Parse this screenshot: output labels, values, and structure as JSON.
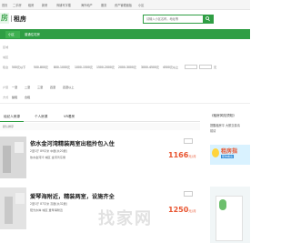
{
  "topnav": {
    "items": [
      "首页",
      "二手房",
      "租房",
      "新房",
      "商铺写字楼",
      "海外地产",
      "服务",
      "资产管理面板",
      "小区"
    ]
  },
  "header": {
    "logo_mark": "房",
    "title": "租房",
    "search_placeholder": "请输入小区名称，地址等"
  },
  "greenbar": {
    "items": [
      "小区",
      "普通住宅房",
      "",
      "",
      "",
      ""
    ]
  },
  "filters": {
    "rows": [
      {
        "key": "区域",
        "items": [
          "",
          "",
          "",
          "",
          "",
          "",
          "",
          "",
          "",
          ""
        ]
      },
      {
        "key": "城区",
        "items": []
      },
      {
        "key": "租金",
        "items": [
          "500元以下",
          "500-800元",
          "800-1000元",
          "1000-1500元",
          "1500-2000元",
          "2000-3000元",
          "3000-4500元",
          "4500元以上",
          ""
        ]
      },
      {
        "key": "",
        "items": [
          "",
          "",
          "",
          ""
        ]
      },
      {
        "key": "户型",
        "items": [
          "一室",
          "二室",
          "三室",
          "四室",
          "四室以上"
        ]
      },
      {
        "key": "方式",
        "items": [
          "整租",
          "合租"
        ]
      },
      {
        "key": "",
        "items": [
          "",
          "",
          ""
        ]
      }
    ],
    "price_unit": "元"
  },
  "tabs": {
    "items": [
      "经纪人房源",
      "个人房源",
      "VR看房"
    ]
  },
  "sort": {
    "items": [
      "默认排序",
      "",
      ""
    ]
  },
  "listings": [
    {
      "title": "依水金河湾精装两室出租拎包入住",
      "meta": "2室1厅  89平米  中层(共20层)",
      "location": "依水金河湾  城区  金河湾东侧",
      "tags": [
        "",
        "",
        ""
      ],
      "price": "1166",
      "price_unit": "元/月"
    },
    {
      "title": "爱琴海附近，精装两室，设施齐全",
      "meta": "2室1厅  87平米  高层(共32层)",
      "location": "阳光水岸  城区  爱琴海附近",
      "tags": [
        "",
        "",
        ""
      ],
      "price": "1250",
      "price_unit": "元/月"
    }
  ],
  "sidebar": {
    "title": "《租房风险须知》",
    "lines": [
      "提醒租房平 大额交易请",
      "前请"
    ],
    "ad_big": "租房指",
    "ad_small": "帮你看房"
  },
  "watermark": "找家网"
}
